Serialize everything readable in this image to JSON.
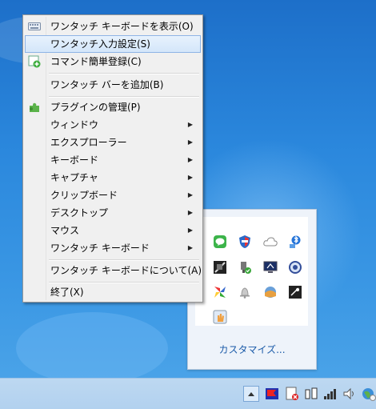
{
  "menu": {
    "items": [
      {
        "label": "ワンタッチ キーボードを表示(O)",
        "submenu": false,
        "icon": "keyboard-icon"
      },
      {
        "label": "ワンタッチ入力設定(S)",
        "submenu": false,
        "icon": "",
        "highlighted": true
      },
      {
        "label": "コマンド簡単登録(C)",
        "submenu": false,
        "icon": "add-command-icon"
      },
      {
        "label": "ワンタッチ バーを追加(B)",
        "submenu": false,
        "icon": ""
      },
      {
        "label": "プラグインの管理(P)",
        "submenu": false,
        "icon": "plugin-puzzle-icon"
      },
      {
        "label": "ウィンドウ",
        "submenu": true
      },
      {
        "label": "エクスプローラー",
        "submenu": true
      },
      {
        "label": "キーボード",
        "submenu": true
      },
      {
        "label": "キャプチャ",
        "submenu": true
      },
      {
        "label": "クリップボード",
        "submenu": true
      },
      {
        "label": "デスクトップ",
        "submenu": true
      },
      {
        "label": "マウス",
        "submenu": true
      },
      {
        "label": "ワンタッチ キーボード",
        "submenu": true
      },
      {
        "label": "ワンタッチ キーボードについて(A)",
        "submenu": false
      },
      {
        "label": "終了(X)",
        "submenu": false
      }
    ]
  },
  "tray_overflow": {
    "customize_label": "カスタマイズ...",
    "icons": [
      "line-icon",
      "shield-icon",
      "cloud-icon",
      "bluetooth-icon",
      "camera-icon",
      "usb-icon",
      "display-icon",
      "sync-icon",
      "pinwheel-icon",
      "bell-icon",
      "weather-icon",
      "app-icon",
      "hand-icon"
    ]
  },
  "taskbar": {
    "tray_icons": [
      "show-hidden-icons-arrow",
      "flag-app-icon",
      "action-center-icon",
      "network-icon",
      "signal-icon",
      "volume-icon",
      "globe-icon"
    ]
  },
  "colors": {
    "highlight_border": "#8fb4e6",
    "menu_bg": "#f0f0f0",
    "customize_link": "#1a5aa8"
  }
}
